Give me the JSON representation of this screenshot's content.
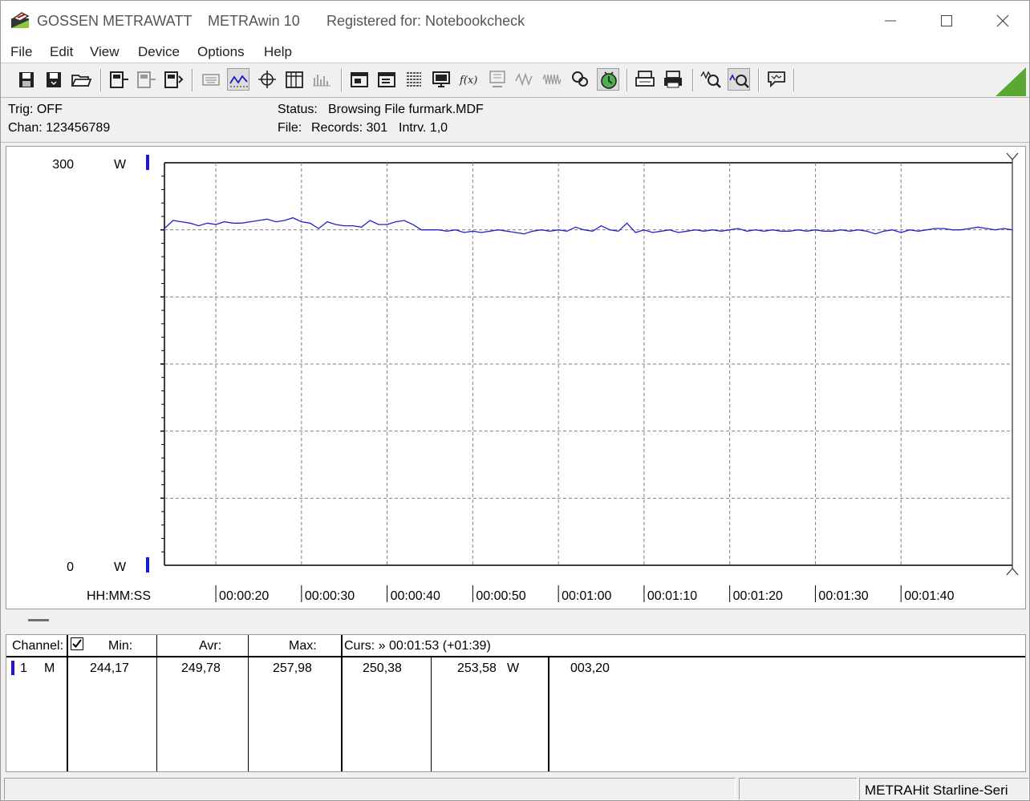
{
  "titlebar": {
    "brand": "GOSSEN METRAWATT",
    "app": "METRAwin 10",
    "registered": "Registered for: Notebookcheck"
  },
  "menu": [
    "File",
    "Edit",
    "View",
    "Device",
    "Options",
    "Help"
  ],
  "info": {
    "trig": "Trig: OFF",
    "chan": "Chan:  123456789",
    "status_label": "Status:",
    "status_value": "Browsing File furmark.MDF",
    "file_label": "File:",
    "records": "Records: 301",
    "interval": "Intrv. 1,0"
  },
  "chart_data": {
    "type": "line",
    "y_top_label": "300",
    "y_bottom_label": "0",
    "y_unit": "W",
    "x_axis_label": "HH:MM:SS",
    "ylim": [
      0,
      300
    ],
    "xlim_seconds": [
      14,
      113
    ],
    "grid": true,
    "x_ticks": [
      "00:00:20",
      "00:00:30",
      "00:00:40",
      "00:00:50",
      "00:01:00",
      "00:01:10",
      "00:01:20",
      "00:01:30",
      "00:01:40"
    ],
    "series": [
      {
        "color": "#2222cc",
        "x": [
          "00:00:14",
          "00:00:15",
          "00:00:16",
          "00:00:17",
          "00:00:18",
          "00:00:19",
          "00:00:20",
          "00:00:21",
          "00:00:22",
          "00:00:23",
          "00:00:24",
          "00:00:25",
          "00:00:26",
          "00:00:27",
          "00:00:28",
          "00:00:29",
          "00:00:30",
          "00:00:31",
          "00:00:32",
          "00:00:33",
          "00:00:34",
          "00:00:35",
          "00:00:36",
          "00:00:37",
          "00:00:38",
          "00:00:39",
          "00:00:40",
          "00:00:41",
          "00:00:42",
          "00:00:43",
          "00:00:44",
          "00:00:45",
          "00:00:46",
          "00:00:47",
          "00:00:48",
          "00:00:49",
          "00:00:50",
          "00:00:51",
          "00:00:52",
          "00:00:53",
          "00:00:54",
          "00:00:55",
          "00:00:56",
          "00:00:57",
          "00:00:58",
          "00:00:59",
          "00:01:00",
          "00:01:01",
          "00:01:02",
          "00:01:03",
          "00:01:04",
          "00:01:05",
          "00:01:06",
          "00:01:07",
          "00:01:08",
          "00:01:09",
          "00:01:10",
          "00:01:11",
          "00:01:12",
          "00:01:13",
          "00:01:14",
          "00:01:15",
          "00:01:16",
          "00:01:17",
          "00:01:18",
          "00:01:19",
          "00:01:20",
          "00:01:21",
          "00:01:22",
          "00:01:23",
          "00:01:24",
          "00:01:25",
          "00:01:26",
          "00:01:27",
          "00:01:28",
          "00:01:29",
          "00:01:30",
          "00:01:31",
          "00:01:32",
          "00:01:33",
          "00:01:34",
          "00:01:35",
          "00:01:36",
          "00:01:37",
          "00:01:38",
          "00:01:39",
          "00:01:40",
          "00:01:41",
          "00:01:42",
          "00:01:43",
          "00:01:44",
          "00:01:45",
          "00:01:46",
          "00:01:47",
          "00:01:48",
          "00:01:49",
          "00:01:50",
          "00:01:51",
          "00:01:52",
          "00:01:53"
        ],
        "values": [
          251,
          257,
          256,
          255,
          253,
          255,
          254,
          256,
          255,
          255,
          256,
          257,
          258,
          256,
          257,
          259,
          256,
          255,
          251,
          256,
          254,
          253,
          253,
          252,
          257,
          254,
          254,
          256,
          257,
          254,
          250,
          250,
          250,
          249,
          250,
          248,
          249,
          248,
          249,
          250,
          249,
          248,
          247,
          249,
          250,
          249,
          250,
          249,
          252,
          250,
          249,
          253,
          250,
          249,
          255,
          248,
          250,
          248,
          249,
          250,
          248,
          249,
          250,
          249,
          250,
          249,
          250,
          251,
          249,
          250,
          249,
          250,
          249,
          249,
          250,
          249,
          250,
          249,
          249,
          250,
          249,
          250,
          249,
          247,
          249,
          250,
          248,
          250,
          249,
          250,
          251,
          251,
          250,
          250,
          251,
          252,
          251,
          250,
          251,
          250
        ]
      }
    ]
  },
  "table": {
    "headers": {
      "channel": "Channel:",
      "min": "Min:",
      "avr": "Avr:",
      "max": "Max:",
      "curs": "Curs: » 00:01:53 (+01:39)"
    },
    "row": {
      "num": "1",
      "mode": "M",
      "min": "244,17",
      "avr": "249,78",
      "max": "257,98",
      "curs1": "250,38",
      "curs2": "253,58",
      "unit": "W",
      "delta": "003,20"
    }
  },
  "statusbar": {
    "device": "METRAHit Starline-Seri"
  },
  "colors": {
    "series": "#2222cc",
    "marker": "#1a1acc",
    "grid": "#808080"
  }
}
